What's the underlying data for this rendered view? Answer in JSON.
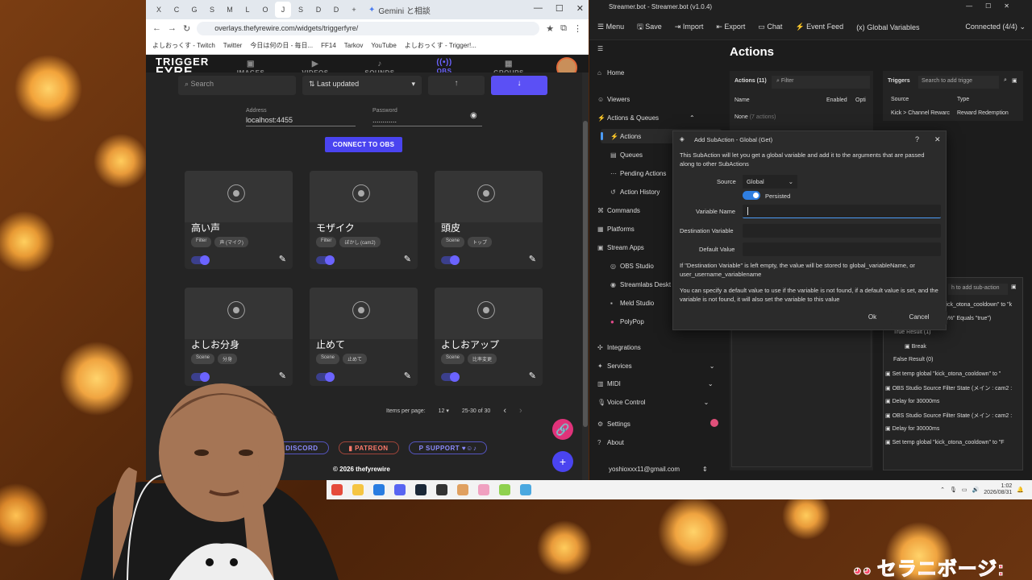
{
  "browser": {
    "tabs": [
      "X",
      "C",
      "G",
      "S",
      "M",
      "L",
      "O",
      "J",
      "S",
      "D",
      "D",
      "+"
    ],
    "gemini_tab": "Gemini と相談",
    "url": "overlays.thefyrewire.com/widgets/triggerfyre/",
    "bookmarks": [
      "よしおっくす - Twitch",
      "Twitter",
      "今日は何の日 - 毎日...",
      "FF14",
      "Tarkov",
      "YouTube",
      "よしおっくす - Trigger!..."
    ]
  },
  "triggerfyre": {
    "logo_top": "TRIGGER",
    "logo_bottom": "FYRE",
    "nav": [
      {
        "label": "IMAGES",
        "icon": "▣"
      },
      {
        "label": "VIDEOS",
        "icon": "▶"
      },
      {
        "label": "SOUNDS",
        "icon": "♪"
      },
      {
        "label": "OBS",
        "icon": "((•))"
      },
      {
        "label": "GROUPS",
        "icon": "▦"
      }
    ],
    "search_placeholder": "Search",
    "sort": "Last updated",
    "address_label": "Address",
    "address_value": "localhost:4455",
    "password_label": "Password",
    "password_value": "............",
    "connect_button": "CONNECT TO OBS",
    "cards": [
      {
        "title": "高い声",
        "chips": [
          "Filter",
          "声 (マイク)"
        ]
      },
      {
        "title": "モザイク",
        "chips": [
          "Filter",
          "ぼかし (cam2)"
        ]
      },
      {
        "title": "頭皮",
        "chips": [
          "Scene",
          "トップ"
        ]
      },
      {
        "title": "よしお分身",
        "chips": [
          "Scene",
          "分身"
        ]
      },
      {
        "title": "止めて",
        "chips": [
          "Scene",
          "止めて"
        ]
      },
      {
        "title": "よしおアップ",
        "chips": [
          "Scene",
          "比率変更"
        ]
      }
    ],
    "items_per_page_label": "Items per page:",
    "items_per_page": "12",
    "range": "25-30 of 30",
    "footer_links": [
      "ER",
      "DISCORD",
      "PATREON",
      "SUPPORT ♥☺♪"
    ],
    "copyright": "© 2026 thefyrewire"
  },
  "streamerbot": {
    "title": "Streamer.bot - Streamer.bot (v1.0.4)",
    "menu": [
      "Menu",
      "Save",
      "Import",
      "Export",
      "Chat",
      "Event Feed",
      "Global Variables"
    ],
    "connected": "Connected (4/4)",
    "sidebar": [
      "Home",
      "Viewers",
      "Actions & Queues",
      "Actions",
      "Queues",
      "Pending Actions",
      "Action History",
      "Commands",
      "Platforms",
      "Stream Apps",
      "OBS Studio",
      "Streamlabs Deskt",
      "Meld Studio",
      "PolyPop",
      "Integrations",
      "Services",
      "MIDI",
      "Voice Control",
      "Settings",
      "About"
    ],
    "account": "yoshioxxx11@gmail.com",
    "page_title": "Actions",
    "actions_label": "Actions",
    "actions_count": "(11)",
    "filter_placeholder": "Filter",
    "col_name": "Name",
    "col_enabled": "Enabled",
    "col_options": "Opti",
    "none_row": "None",
    "none_sub": "(7 actions)",
    "triggers_label": "Triggers",
    "triggers_search": "Search to add trigge",
    "col_source": "Source",
    "col_type": "Type",
    "trigger_source": "Kick > Channel Rewarc",
    "trigger_type": "Reward Redemption",
    "subaction_search": "h to add sub-action",
    "subactions": [
      "kick_otona_cooldown\" to \"k",
      "m%\" Equals \"true\")",
      "True Result (1)",
      "Break",
      "False Result (0)",
      "Set temp global \"kick_otona_cooldown\" to \"",
      "OBS Studio Source Filter State (メイン : cam2 :",
      "Delay for 30000ms",
      "OBS Studio Source Filter State (メイン : cam2 :",
      "Delay for 30000ms",
      "Set temp global \"kick_otona_cooldown\" to \"F"
    ]
  },
  "dialog": {
    "title": "Add SubAction - Global (Get)",
    "desc": "This SubAction will let you get a global variable and add it to the arguments that are passed along to other SubActions",
    "source_label": "Source",
    "source_value": "Global",
    "persisted": "Persisted",
    "var_name_label": "Variable Name",
    "dest_label": "Destination Variable",
    "default_label": "Default Value",
    "note1": "If \"Destination Variable\" is left empty, the value will be stored to global_variableName, or user_username_variablename",
    "note2": "You can specify a default value to use if the variable is not found, if a default value is set, and the variable is not found, it will also set the variable to this value",
    "ok": "Ok",
    "cancel": "Cancel"
  },
  "taskbar": {
    "time": "1:02",
    "date": "2026/08/31"
  },
  "overlay_text": "セラニボージ:"
}
